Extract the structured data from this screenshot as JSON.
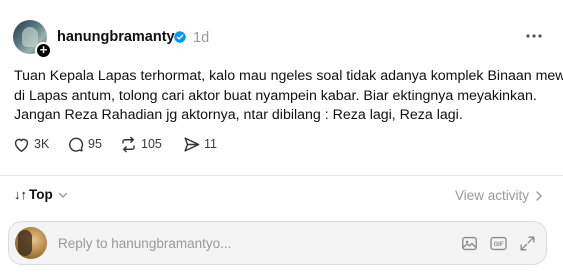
{
  "post": {
    "username": "hanungbramantyo",
    "time": "1d",
    "text_lines": [
      "Tuan Kepala Lapas terhormat, kalo mau ngeles soal tidak adanya komplek Binaan mewah",
      "di Lapas antum, tolong cari aktor buat nyampein kabar. Biar ektingnya meyakinkan.",
      "Jangan Reza Rahadian jg aktornya, ntar dibilang : Reza lagi, Reza lagi."
    ],
    "follow_badge": "+"
  },
  "actions": {
    "likes": "3K",
    "replies": "95",
    "reposts": "105",
    "shares": "11"
  },
  "sort": {
    "label": "Top",
    "icon": "↓↑"
  },
  "view_activity": "View activity",
  "reply_bar": {
    "placeholder": "Reply to hanungbramantyo..."
  },
  "icons": {
    "verified": "verified-badge-icon",
    "more": "more-icon",
    "like": "heart-icon",
    "reply": "comment-icon",
    "repost": "repost-icon",
    "share": "send-icon",
    "image": "image-icon",
    "gif": "gif-icon",
    "expand": "expand-icon"
  },
  "colors": {
    "verified_blue": "#0095f6",
    "muted_text": "#999999",
    "primary_text": "#101010"
  }
}
